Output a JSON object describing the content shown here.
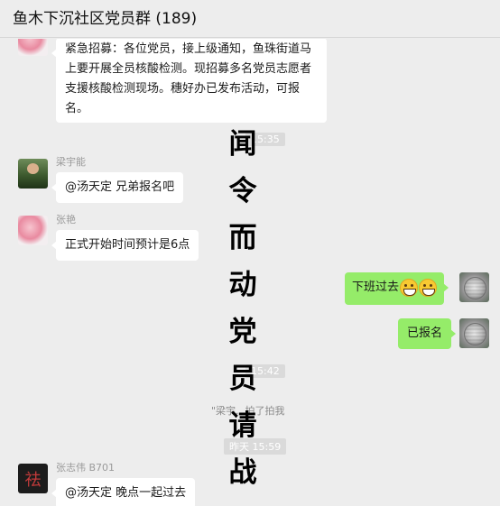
{
  "header": {
    "title": "鱼木下沉社区党员群 (189)"
  },
  "messages": [
    {
      "id": "m1",
      "text": "紧急招募：各位党员，接上级通知，鱼珠街道马上要开展全员核酸检测。现招募多名党员志愿者支援核酸检测现场。穗好办已发布活动，可报名。"
    },
    {
      "id": "m2",
      "sender": "梁宇能",
      "text": "@汤天定 兄弟报名吧"
    },
    {
      "id": "m3",
      "sender": "张艳",
      "text": "正式开始时间预计是6点"
    },
    {
      "id": "m4",
      "text": "下班过去",
      "emoji": [
        "grinning-emoji",
        "grinning-emoji"
      ]
    },
    {
      "id": "m5",
      "text": "已报名"
    },
    {
      "id": "m6",
      "sender": "张志伟 B701",
      "text": "@汤天定 晚点一起过去"
    }
  ],
  "timestamps": [
    "15:35",
    "15:42",
    "昨天 15:59"
  ],
  "system_notice": "\"梁宇...拍了拍我",
  "avatar_glyph": "祛",
  "overlay": {
    "chars": [
      "闻",
      "令",
      "而",
      "动",
      "党",
      "员",
      "请",
      "战"
    ]
  }
}
